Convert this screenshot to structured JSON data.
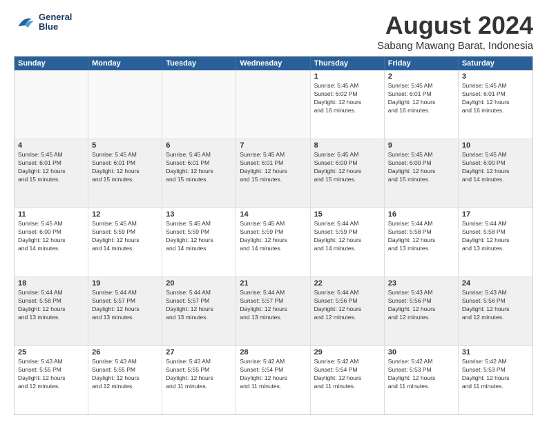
{
  "logo": {
    "line1": "General",
    "line2": "Blue"
  },
  "header": {
    "month": "August 2024",
    "location": "Sabang Mawang Barat, Indonesia"
  },
  "days_of_week": [
    "Sunday",
    "Monday",
    "Tuesday",
    "Wednesday",
    "Thursday",
    "Friday",
    "Saturday"
  ],
  "rows": [
    [
      {
        "day": "",
        "text": "",
        "empty": true
      },
      {
        "day": "",
        "text": "",
        "empty": true
      },
      {
        "day": "",
        "text": "",
        "empty": true
      },
      {
        "day": "",
        "text": "",
        "empty": true
      },
      {
        "day": "1",
        "text": "Sunrise: 5:45 AM\nSunset: 6:02 PM\nDaylight: 12 hours\nand 16 minutes.",
        "empty": false
      },
      {
        "day": "2",
        "text": "Sunrise: 5:45 AM\nSunset: 6:01 PM\nDaylight: 12 hours\nand 16 minutes.",
        "empty": false
      },
      {
        "day": "3",
        "text": "Sunrise: 5:45 AM\nSunset: 6:01 PM\nDaylight: 12 hours\nand 16 minutes.",
        "empty": false
      }
    ],
    [
      {
        "day": "4",
        "text": "Sunrise: 5:45 AM\nSunset: 6:01 PM\nDaylight: 12 hours\nand 15 minutes.",
        "empty": false
      },
      {
        "day": "5",
        "text": "Sunrise: 5:45 AM\nSunset: 6:01 PM\nDaylight: 12 hours\nand 15 minutes.",
        "empty": false
      },
      {
        "day": "6",
        "text": "Sunrise: 5:45 AM\nSunset: 6:01 PM\nDaylight: 12 hours\nand 15 minutes.",
        "empty": false
      },
      {
        "day": "7",
        "text": "Sunrise: 5:45 AM\nSunset: 6:01 PM\nDaylight: 12 hours\nand 15 minutes.",
        "empty": false
      },
      {
        "day": "8",
        "text": "Sunrise: 5:45 AM\nSunset: 6:00 PM\nDaylight: 12 hours\nand 15 minutes.",
        "empty": false
      },
      {
        "day": "9",
        "text": "Sunrise: 5:45 AM\nSunset: 6:00 PM\nDaylight: 12 hours\nand 15 minutes.",
        "empty": false
      },
      {
        "day": "10",
        "text": "Sunrise: 5:45 AM\nSunset: 6:00 PM\nDaylight: 12 hours\nand 14 minutes.",
        "empty": false
      }
    ],
    [
      {
        "day": "11",
        "text": "Sunrise: 5:45 AM\nSunset: 6:00 PM\nDaylight: 12 hours\nand 14 minutes.",
        "empty": false
      },
      {
        "day": "12",
        "text": "Sunrise: 5:45 AM\nSunset: 5:59 PM\nDaylight: 12 hours\nand 14 minutes.",
        "empty": false
      },
      {
        "day": "13",
        "text": "Sunrise: 5:45 AM\nSunset: 5:59 PM\nDaylight: 12 hours\nand 14 minutes.",
        "empty": false
      },
      {
        "day": "14",
        "text": "Sunrise: 5:45 AM\nSunset: 5:59 PM\nDaylight: 12 hours\nand 14 minutes.",
        "empty": false
      },
      {
        "day": "15",
        "text": "Sunrise: 5:44 AM\nSunset: 5:59 PM\nDaylight: 12 hours\nand 14 minutes.",
        "empty": false
      },
      {
        "day": "16",
        "text": "Sunrise: 5:44 AM\nSunset: 5:58 PM\nDaylight: 12 hours\nand 13 minutes.",
        "empty": false
      },
      {
        "day": "17",
        "text": "Sunrise: 5:44 AM\nSunset: 5:58 PM\nDaylight: 12 hours\nand 13 minutes.",
        "empty": false
      }
    ],
    [
      {
        "day": "18",
        "text": "Sunrise: 5:44 AM\nSunset: 5:58 PM\nDaylight: 12 hours\nand 13 minutes.",
        "empty": false
      },
      {
        "day": "19",
        "text": "Sunrise: 5:44 AM\nSunset: 5:57 PM\nDaylight: 12 hours\nand 13 minutes.",
        "empty": false
      },
      {
        "day": "20",
        "text": "Sunrise: 5:44 AM\nSunset: 5:57 PM\nDaylight: 12 hours\nand 13 minutes.",
        "empty": false
      },
      {
        "day": "21",
        "text": "Sunrise: 5:44 AM\nSunset: 5:57 PM\nDaylight: 12 hours\nand 13 minutes.",
        "empty": false
      },
      {
        "day": "22",
        "text": "Sunrise: 5:44 AM\nSunset: 5:56 PM\nDaylight: 12 hours\nand 12 minutes.",
        "empty": false
      },
      {
        "day": "23",
        "text": "Sunrise: 5:43 AM\nSunset: 5:56 PM\nDaylight: 12 hours\nand 12 minutes.",
        "empty": false
      },
      {
        "day": "24",
        "text": "Sunrise: 5:43 AM\nSunset: 5:56 PM\nDaylight: 12 hours\nand 12 minutes.",
        "empty": false
      }
    ],
    [
      {
        "day": "25",
        "text": "Sunrise: 5:43 AM\nSunset: 5:55 PM\nDaylight: 12 hours\nand 12 minutes.",
        "empty": false
      },
      {
        "day": "26",
        "text": "Sunrise: 5:43 AM\nSunset: 5:55 PM\nDaylight: 12 hours\nand 12 minutes.",
        "empty": false
      },
      {
        "day": "27",
        "text": "Sunrise: 5:43 AM\nSunset: 5:55 PM\nDaylight: 12 hours\nand 11 minutes.",
        "empty": false
      },
      {
        "day": "28",
        "text": "Sunrise: 5:42 AM\nSunset: 5:54 PM\nDaylight: 12 hours\nand 11 minutes.",
        "empty": false
      },
      {
        "day": "29",
        "text": "Sunrise: 5:42 AM\nSunset: 5:54 PM\nDaylight: 12 hours\nand 11 minutes.",
        "empty": false
      },
      {
        "day": "30",
        "text": "Sunrise: 5:42 AM\nSunset: 5:53 PM\nDaylight: 12 hours\nand 11 minutes.",
        "empty": false
      },
      {
        "day": "31",
        "text": "Sunrise: 5:42 AM\nSunset: 5:53 PM\nDaylight: 12 hours\nand 11 minutes.",
        "empty": false
      }
    ]
  ]
}
